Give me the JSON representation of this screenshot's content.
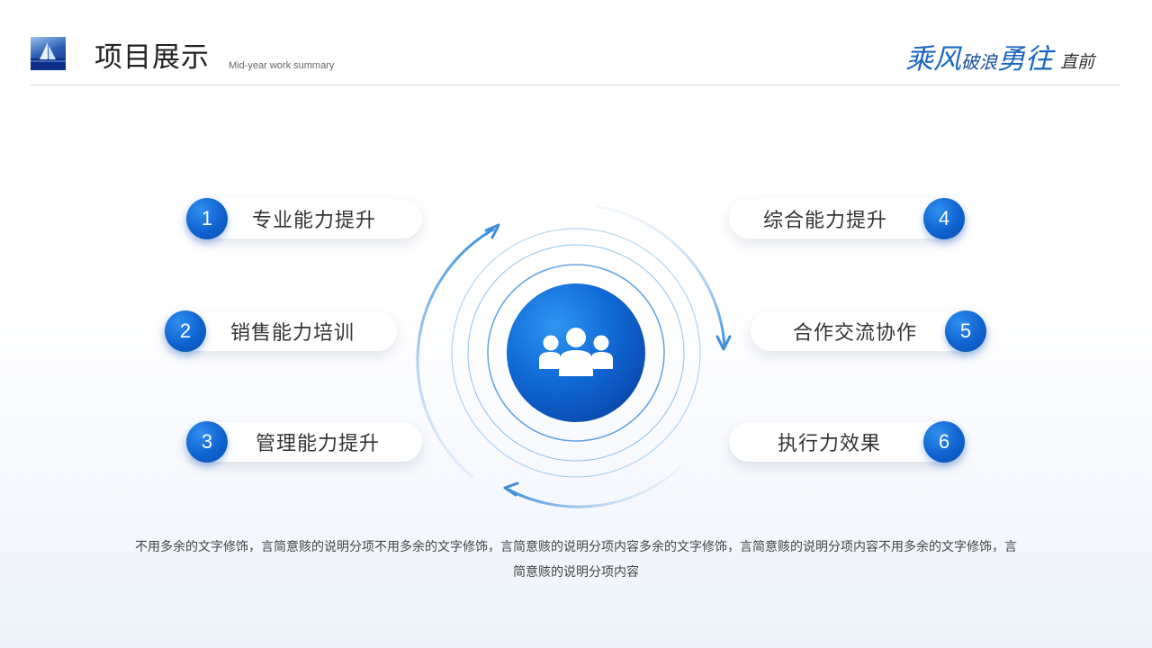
{
  "header": {
    "title": "项目展示",
    "subtitle": "Mid-year work summary",
    "slogan": {
      "part1": "乘风",
      "part2": "破浪",
      "part3": "勇往",
      "part4": "直前"
    }
  },
  "items": [
    {
      "number": "1",
      "label": "专业能力提升"
    },
    {
      "number": "2",
      "label": "销售能力培训"
    },
    {
      "number": "3",
      "label": "管理能力提升"
    },
    {
      "number": "4",
      "label": "综合能力提升"
    },
    {
      "number": "5",
      "label": "合作交流协作"
    },
    {
      "number": "6",
      "label": "执行力效果"
    }
  ],
  "center": {
    "icon": "users-icon"
  },
  "description": "不用多余的文字修饰，言简意赅的说明分项不用多余的文字修饰，言简意赅的说明分项内容多余的文字修饰，言简意赅的说明分项内容不用多余的文字修饰，言简意赅的说明分项内容",
  "colors": {
    "accent": "#0f63cf",
    "accent_light": "#2f8ff0",
    "rule": "#d3d6dc"
  }
}
